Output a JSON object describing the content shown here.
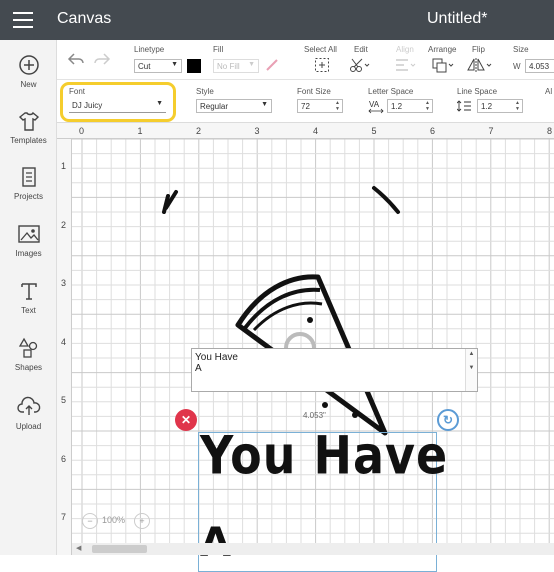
{
  "header": {
    "app_title": "Canvas",
    "doc_title": "Untitled*"
  },
  "sidebar": {
    "items": [
      {
        "label": "New",
        "icon": "plus-circle-icon"
      },
      {
        "label": "Templates",
        "icon": "shirt-icon"
      },
      {
        "label": "Projects",
        "icon": "projects-icon"
      },
      {
        "label": "Images",
        "icon": "image-icon"
      },
      {
        "label": "Text",
        "icon": "text-icon"
      },
      {
        "label": "Shapes",
        "icon": "shapes-icon"
      },
      {
        "label": "Upload",
        "icon": "cloud-upload-icon"
      }
    ]
  },
  "toolbar": {
    "linetype_label": "Linetype",
    "linetype_value": "Cut",
    "fill_label": "Fill",
    "fill_value": "No Fill",
    "select_all_label": "Select All",
    "edit_label": "Edit",
    "align_label": "Align",
    "arrange_label": "Arrange",
    "flip_label": "Flip",
    "size_label": "Size",
    "size_w_prefix": "W",
    "size_w_value": "4.053"
  },
  "fontbar": {
    "font_label": "Font",
    "font_value": "DJ Juicy",
    "style_label": "Style",
    "style_value": "Regular",
    "font_size_label": "Font Size",
    "font_size_value": "72",
    "letter_space_label": "Letter Space",
    "letter_space_value": "1.2",
    "line_space_label": "Line Space",
    "line_space_value": "1.2",
    "cut_label": "Al"
  },
  "ruler": {
    "h_ticks": [
      "0",
      "1",
      "2",
      "3",
      "4",
      "5",
      "6",
      "7",
      "8"
    ],
    "v_ticks": [
      "1",
      "2",
      "3",
      "4",
      "5",
      "6",
      "7"
    ]
  },
  "canvas": {
    "textbox_line1": "You Have",
    "textbox_line2": "A",
    "width_readout": "4.053\"",
    "headline": "You Have",
    "next_line_partial": "A",
    "zoom": "100%"
  },
  "colors": {
    "topbar": "#444a50",
    "highlight": "#f5cd2d",
    "delete": "#e0354b",
    "rotate": "#5b9bd5"
  }
}
